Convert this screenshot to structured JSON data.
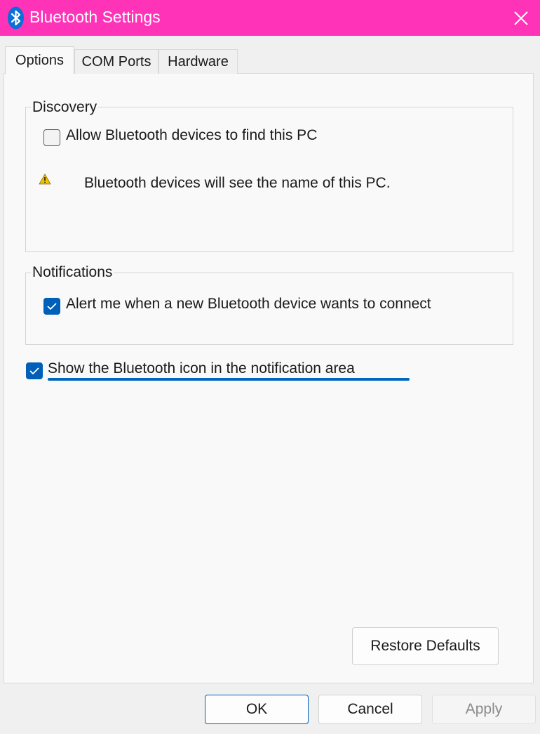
{
  "window": {
    "title": "Bluetooth Settings",
    "titlebar_color": "#ff33b8",
    "app_icon": "bluetooth-icon",
    "close_icon": "close-icon"
  },
  "tabs": [
    {
      "label": "Options",
      "active": true
    },
    {
      "label": "COM Ports",
      "active": false
    },
    {
      "label": "Hardware",
      "active": false
    }
  ],
  "discovery": {
    "legend": "Discovery",
    "allow_checkbox": {
      "label": "Allow Bluetooth devices to find this PC",
      "checked": false
    },
    "warning_icon": "warning-icon",
    "warning_text": "Bluetooth devices will see the name of this PC."
  },
  "notifications": {
    "legend": "Notifications",
    "alert_checkbox": {
      "label": "Alert me when a new Bluetooth device wants to connect",
      "checked": true
    }
  },
  "show_icon_checkbox": {
    "label": "Show the Bluetooth icon in the notification area",
    "checked": true
  },
  "buttons": {
    "restore_defaults": "Restore Defaults",
    "ok": "OK",
    "cancel": "Cancel",
    "apply": "Apply",
    "apply_enabled": false
  },
  "accent_color": "#005fb8"
}
